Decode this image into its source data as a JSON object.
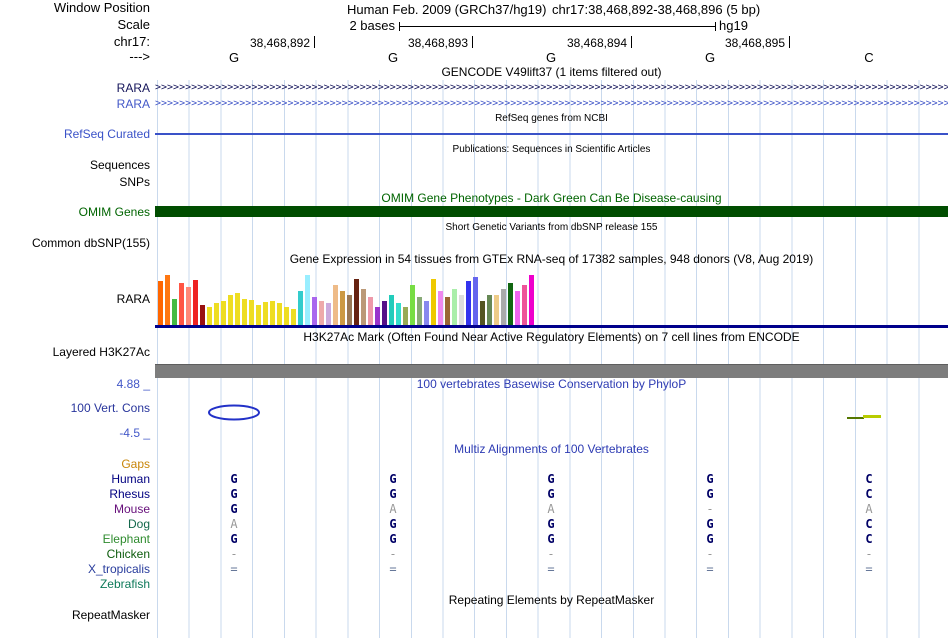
{
  "header": {
    "window_position_label": "Window Position",
    "assembly": "Human Feb. 2009 (GRCh37/hg19)",
    "range": "chr17:38,468,892-38,468,896 (5 bp)",
    "scale_label": "Scale",
    "scale_value": "2 bases",
    "genome": "hg19",
    "chrom_label": "chr17:",
    "strand_label": "--->",
    "coordinates": [
      "38,468,892",
      "38,468,893",
      "38,468,894",
      "38,468,895"
    ],
    "bases": [
      "G",
      "G",
      "G",
      "G",
      "C"
    ]
  },
  "tracks": {
    "gencode": {
      "title": "GENCODE V49lift37 (1 items filtered out)",
      "items": [
        {
          "label": "RARA",
          "color": "#14145a"
        },
        {
          "label": "RARA",
          "color": "#4358c8"
        }
      ]
    },
    "refseq": {
      "title": "RefSeq genes from NCBI",
      "label": "RefSeq Curated"
    },
    "publications": {
      "title": "Publications: Sequences in Scientific Articles",
      "label": "Sequences"
    },
    "snps_label": "SNPs",
    "omim": {
      "title": "OMIM Gene Phenotypes - Dark Green Can Be Disease-causing",
      "label": "OMIM Genes"
    },
    "dbsnp": {
      "title": "Short Genetic Variants from dbSNP release 155",
      "label": "Common dbSNP(155)"
    },
    "gtex": {
      "title": "Gene Expression in 54 tissues from GTEx RNA-seq of 17382 samples, 948 donors (V8, Aug 2019)",
      "label": "RARA"
    },
    "h3k27ac": {
      "title": "H3K27Ac Mark (Often Found Near Active Regulatory Elements) on 7 cell lines from ENCODE",
      "label": "Layered H3K27Ac"
    },
    "phylop": {
      "title": "100 vertebrates Basewise Conservation by PhyloP",
      "label": "100 Vert. Cons",
      "max_label": "4.88 _",
      "min_label": "-4.5 _"
    },
    "multiz": {
      "title": "Multiz Alignments of 100 Vertebrates",
      "rows": [
        {
          "name": "Gaps",
          "color": "#c8860a",
          "cells": [
            "",
            "",
            "",
            "",
            ""
          ],
          "shades": [
            "",
            "",
            "",
            "",
            ""
          ]
        },
        {
          "name": "Human",
          "color": "#000080",
          "cells": [
            "G",
            "G",
            "G",
            "G",
            "C"
          ],
          "shades": [
            "d",
            "d",
            "d",
            "d",
            "d"
          ]
        },
        {
          "name": "Rhesus",
          "color": "#000080",
          "cells": [
            "G",
            "G",
            "G",
            "G",
            "C"
          ],
          "shades": [
            "d",
            "d",
            "d",
            "d",
            "d"
          ]
        },
        {
          "name": "Mouse",
          "color": "#660e7a",
          "cells": [
            "G",
            "A",
            "A",
            "-",
            "A"
          ],
          "shades": [
            "d",
            "l",
            "l",
            "l",
            "l"
          ]
        },
        {
          "name": "Dog",
          "color": "#14684c",
          "cells": [
            "A",
            "G",
            "G",
            "G",
            "C"
          ],
          "shades": [
            "l",
            "d",
            "d",
            "d",
            "d"
          ]
        },
        {
          "name": "Elephant",
          "color": "#2e8b2e",
          "cells": [
            "G",
            "G",
            "G",
            "G",
            "C"
          ],
          "shades": [
            "d",
            "d",
            "d",
            "d",
            "d"
          ]
        },
        {
          "name": "Chicken",
          "color": "#0d5c0d",
          "cells": [
            "-",
            "-",
            "-",
            "-",
            "-"
          ],
          "shades": [
            "l",
            "l",
            "l",
            "l",
            "l"
          ]
        },
        {
          "name": "X_tropicalis",
          "color": "#283c9c",
          "cells": [
            "=",
            "=",
            "=",
            "=",
            "="
          ],
          "shades": [
            "e",
            "e",
            "e",
            "e",
            "e"
          ]
        },
        {
          "name": "Zebrafish",
          "color": "#0e7a5a",
          "cells": [
            "",
            "",
            "",
            "",
            ""
          ],
          "shades": [
            "",
            "",
            "",
            "",
            ""
          ]
        }
      ]
    },
    "repeatmasker": {
      "title": "Repeating Elements by RepeatMasker",
      "label": "RepeatMasker"
    }
  },
  "chart_data": {
    "type": "bar",
    "title": "Gene Expression in 54 tissues from GTEx RNA-seq of 17382 samples, 948 donors (V8, Aug 2019)",
    "gene": "RARA",
    "bars": [
      {
        "color": "#FF6600",
        "h": 44
      },
      {
        "color": "#FF7711",
        "h": 50
      },
      {
        "color": "#44BB44",
        "h": 26
      },
      {
        "color": "#FF5544",
        "h": 42
      },
      {
        "color": "#FF8877",
        "h": 38
      },
      {
        "color": "#EE2222",
        "h": 45
      },
      {
        "color": "#991111",
        "h": 20
      },
      {
        "color": "#EEDD22",
        "h": 18
      },
      {
        "color": "#EEDD22",
        "h": 22
      },
      {
        "color": "#EEDD22",
        "h": 24
      },
      {
        "color": "#EEDD22",
        "h": 30
      },
      {
        "color": "#EEDD22",
        "h": 32
      },
      {
        "color": "#EEDD22",
        "h": 26
      },
      {
        "color": "#EEDD22",
        "h": 25
      },
      {
        "color": "#EEDD22",
        "h": 20
      },
      {
        "color": "#EEDD22",
        "h": 23
      },
      {
        "color": "#EEDD22",
        "h": 24
      },
      {
        "color": "#EEDD22",
        "h": 22
      },
      {
        "color": "#EEDD22",
        "h": 18
      },
      {
        "color": "#EEDD22",
        "h": 16
      },
      {
        "color": "#33CCCC",
        "h": 34
      },
      {
        "color": "#99EEFF",
        "h": 50
      },
      {
        "color": "#AA66EE",
        "h": 28
      },
      {
        "color": "#EEAAAA",
        "h": 24
      },
      {
        "color": "#CCAADD",
        "h": 22
      },
      {
        "color": "#EEBB88",
        "h": 40
      },
      {
        "color": "#CC9944",
        "h": 34
      },
      {
        "color": "#997755",
        "h": 30
      },
      {
        "color": "#662211",
        "h": 46
      },
      {
        "color": "#BB9977",
        "h": 36
      },
      {
        "color": "#EE99AA",
        "h": 28
      },
      {
        "color": "#9933CC",
        "h": 18
      },
      {
        "color": "#551188",
        "h": 24
      },
      {
        "color": "#22CCBB",
        "h": 30
      },
      {
        "color": "#33DDCC",
        "h": 22
      },
      {
        "color": "#99AA55",
        "h": 18
      },
      {
        "color": "#77DD44",
        "h": 40
      },
      {
        "color": "#88AA77",
        "h": 28
      },
      {
        "color": "#8888EE",
        "h": 24
      },
      {
        "color": "#EEC900",
        "h": 46
      },
      {
        "color": "#EE88EE",
        "h": 34
      },
      {
        "color": "#996633",
        "h": 28
      },
      {
        "color": "#AAEEAA",
        "h": 36
      },
      {
        "color": "#DDDDDD",
        "h": 30
      },
      {
        "color": "#3333EE",
        "h": 44
      },
      {
        "color": "#6666EE",
        "h": 48
      },
      {
        "color": "#555522",
        "h": 24
      },
      {
        "color": "#668855",
        "h": 30
      },
      {
        "color": "#EECC88",
        "h": 30
      },
      {
        "color": "#AAAAAA",
        "h": 36
      },
      {
        "color": "#116611",
        "h": 42
      },
      {
        "color": "#EE66EE",
        "h": 34
      },
      {
        "color": "#EE5599",
        "h": 40
      },
      {
        "color": "#EE00CC",
        "h": 50
      }
    ]
  }
}
